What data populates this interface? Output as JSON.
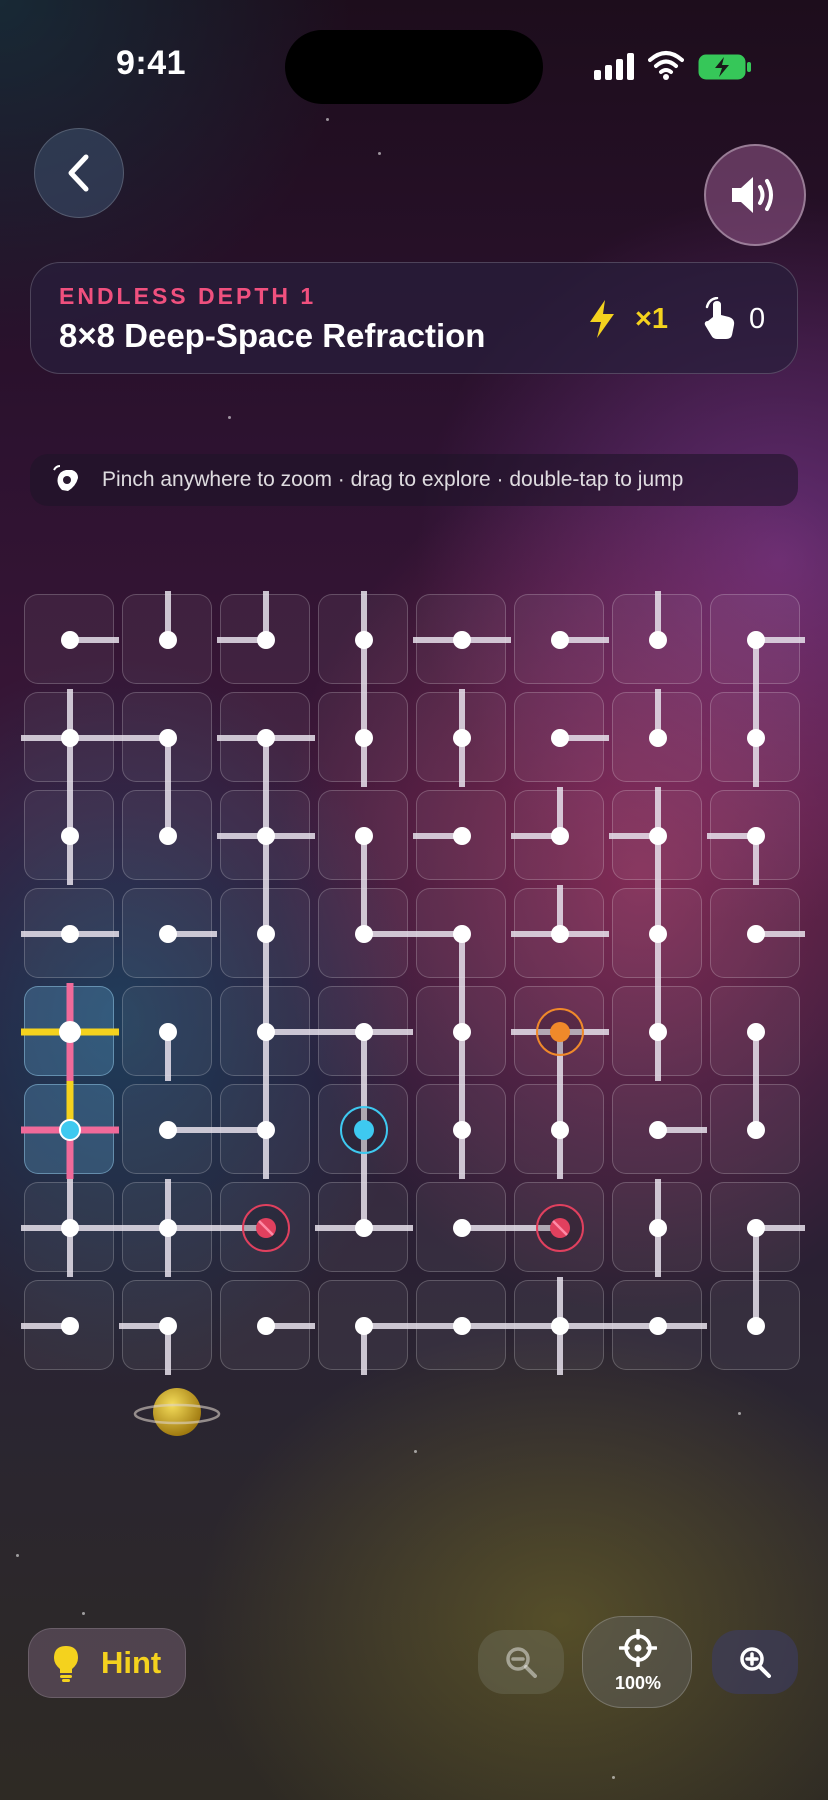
{
  "status_bar": {
    "time": "9:41"
  },
  "header": {
    "back_icon": "chevron-left-icon",
    "sound_icon": "speaker-icon",
    "depth_label": "ENDLESS DEPTH 1",
    "level_title": "8×8 Deep-Space Refraction",
    "multiplier": "×1",
    "moves": "0"
  },
  "tip": {
    "text": "Pinch anywhere to zoom · drag to explore · double-tap to jump",
    "icon": "pinch-gesture-icon"
  },
  "colors": {
    "accent_pink": "#f0507e",
    "accent_yellow": "#f4d21e",
    "beam_cyan": "#3ec9f0",
    "beam_pink": "#f06a9a"
  },
  "board": {
    "rows": 8,
    "cols": 8,
    "legend": "each tile lists connected sides (U,R,D,L); node = source/target/blocked",
    "tiles": [
      [
        "R",
        "U",
        "UL",
        "UD",
        "RL",
        "R",
        "U",
        "RD"
      ],
      [
        "UDRL",
        "LD",
        "RLD",
        "UD",
        "UD",
        "R",
        "U",
        "UD"
      ],
      [
        "UD",
        "U",
        "UDRL",
        "D",
        "L",
        "UL",
        "UDL",
        "LD"
      ],
      [
        "RL",
        "R",
        "UD",
        "UR",
        "LD",
        "URL",
        "UD",
        "R"
      ],
      [
        "UDRL",
        "D",
        "UDR",
        "RLD",
        "UD",
        "RLD",
        "UD",
        "D"
      ],
      [
        "UDRL",
        "R",
        "UDL",
        "UD",
        "UD",
        "UD",
        "R",
        "U"
      ],
      [
        "UDRL",
        "UDRL",
        "L",
        "URL",
        "R",
        "L",
        "UD",
        "RD"
      ],
      [
        "L",
        "LD",
        "R",
        "RD",
        "RL",
        "UDRL",
        "RL",
        "U"
      ]
    ],
    "specials": [
      {
        "row": 4,
        "col": 5,
        "type": "source-orange"
      },
      {
        "row": 5,
        "col": 3,
        "type": "source-cyan"
      },
      {
        "row": 6,
        "col": 2,
        "type": "blocked"
      },
      {
        "row": 6,
        "col": 5,
        "type": "blocked"
      }
    ],
    "lit_tiles": [
      [
        4,
        0
      ],
      [
        5,
        0
      ]
    ]
  },
  "controls": {
    "hint_label": "Hint",
    "zoom_level": "100%"
  }
}
